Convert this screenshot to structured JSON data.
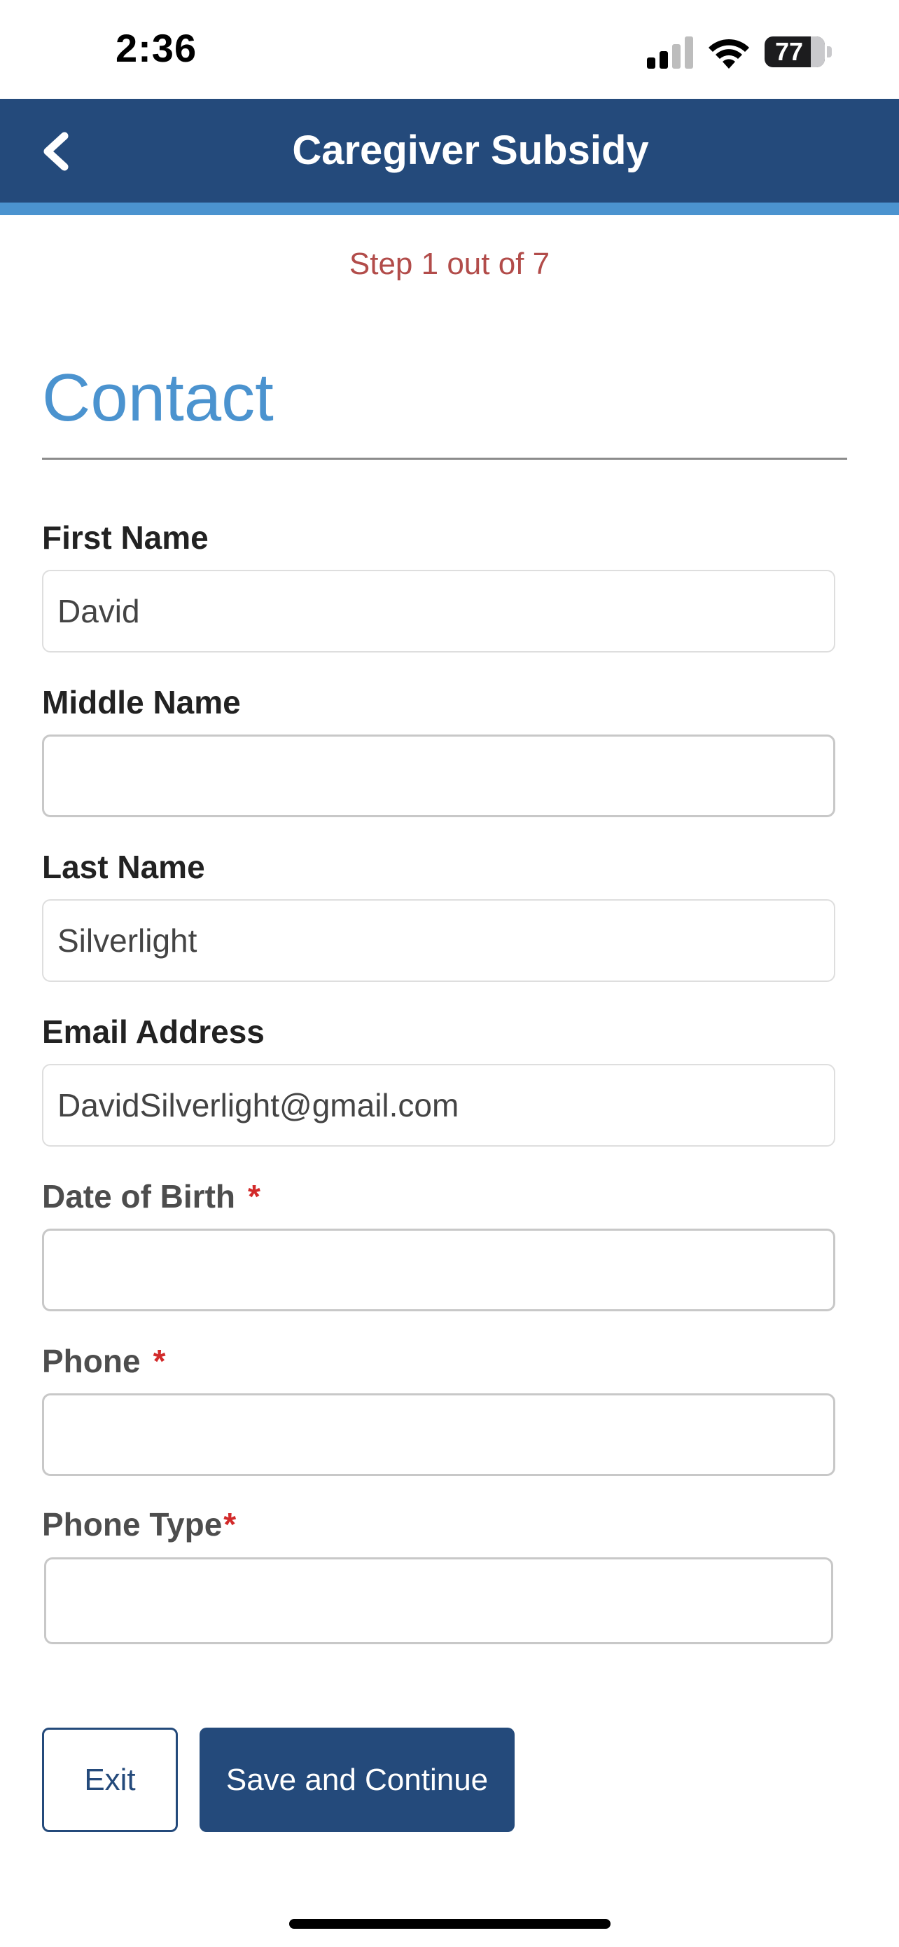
{
  "status_bar": {
    "time": "2:36",
    "battery_level": "77",
    "battery_fraction": 0.77
  },
  "header": {
    "title": "Caregiver Subsidy",
    "back_icon": "chevron-left-icon"
  },
  "step": {
    "text": "Step 1 out of 7"
  },
  "section": {
    "title": "Contact"
  },
  "fields": {
    "first_name": {
      "label": "First Name",
      "value": "David"
    },
    "middle_name": {
      "label": "Middle Name",
      "value": ""
    },
    "last_name": {
      "label": "Last Name",
      "value": "Silverlight"
    },
    "email": {
      "label": "Email Address",
      "value": "DavidSilverlight@gmail.com"
    },
    "date_of_birth": {
      "label": "Date of Birth",
      "required_mark": "*",
      "value": ""
    },
    "phone": {
      "label": "Phone",
      "required_mark": "*",
      "value": ""
    },
    "phone_type": {
      "label": "Phone Type",
      "required_mark": "*",
      "value": ""
    }
  },
  "actions": {
    "exit_label": "Exit",
    "save_label": "Save and Continue"
  },
  "colors": {
    "header_bg": "#244a7b",
    "header_accent": "#4b93cf",
    "section_title": "#4b93cf",
    "step_text": "#b24c4a",
    "required": "#d22a2a"
  }
}
